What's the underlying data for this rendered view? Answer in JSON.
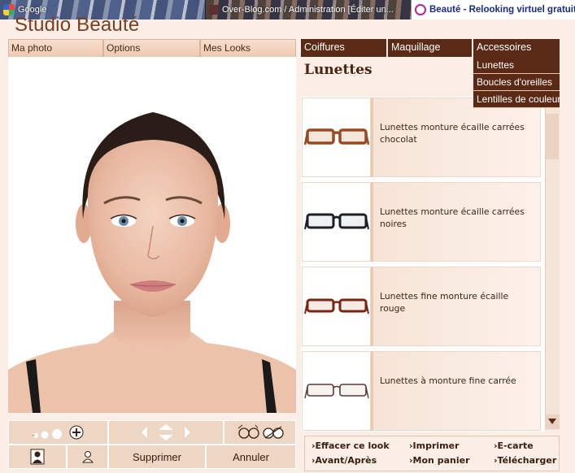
{
  "browser": {
    "tabs": [
      {
        "label": "Google"
      },
      {
        "label": "Over-Blog.com / Administration [Éditer un..."
      },
      {
        "label": "Beauté - Relooking virtuel gratuit"
      }
    ]
  },
  "app": {
    "title": "Studio Beauté"
  },
  "left_tabs": [
    "Ma photo",
    "Options",
    "Mes Looks"
  ],
  "controls": {
    "delete_label": "Supprimer",
    "cancel_label": "Annuler"
  },
  "right_tabs": [
    "Coiffures",
    "Maquillage",
    "Accessoires"
  ],
  "accessories_menu": [
    "Lunettes",
    "Boucles d'oreilles",
    "Lentilles de couleur"
  ],
  "category_title": "Lunettes",
  "products": [
    {
      "name": "Lunettes monture écaille carrées chocolat",
      "frame_color": "#9a4a22",
      "lens_tint": "#f3e6dc"
    },
    {
      "name": "Lunettes monture écaille carrées noires",
      "frame_color": "#1e1f24",
      "lens_tint": "#eef0f2"
    },
    {
      "name": "Lunettes fine  monture écaille rouge",
      "frame_color": "#7a2412",
      "lens_tint": "#f7ebe5"
    },
    {
      "name": "Lunettes à monture fine carrée",
      "frame_color": "#5a3a3a",
      "lens_tint": "#f7f3f1"
    }
  ],
  "footer_links": [
    {
      "label": "Effacer ce look"
    },
    {
      "label": "Imprimer"
    },
    {
      "label": "E-carte"
    },
    {
      "label": "Avant/Après"
    },
    {
      "label": "Mon panier"
    },
    {
      "label": "Télécharger"
    }
  ],
  "colors": {
    "brand_brown": "#5a2a16",
    "title_brown": "#7a3f1e",
    "panel_beige": "#eed6c4",
    "page_bg": "#fbeee6"
  }
}
